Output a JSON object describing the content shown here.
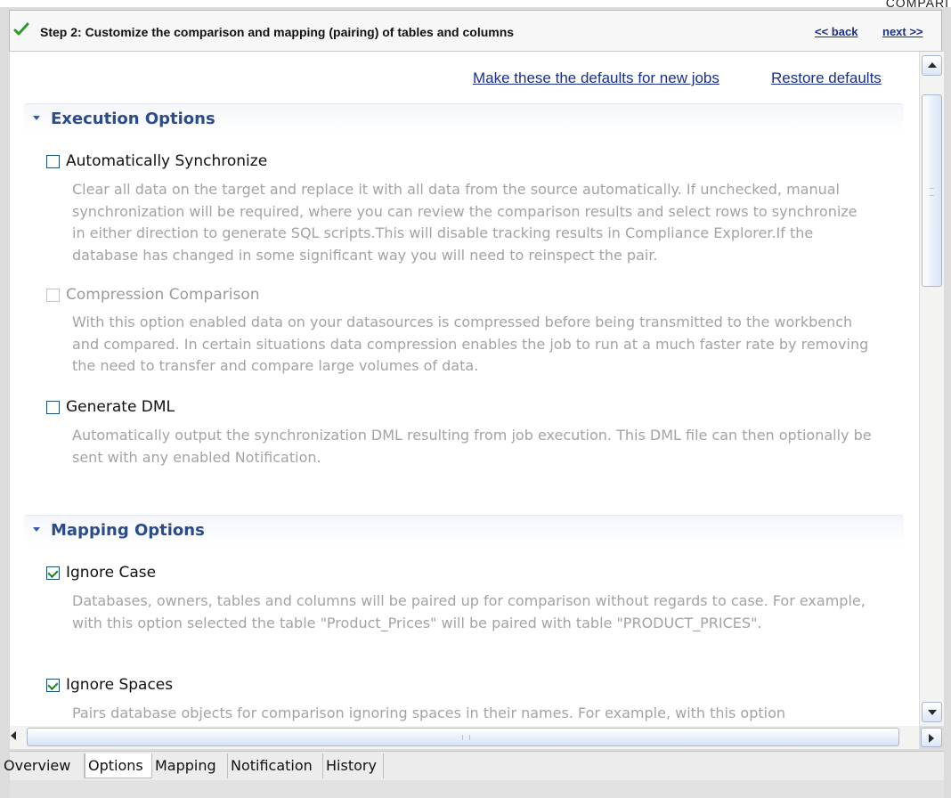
{
  "corner_text": "COMPARI",
  "header": {
    "step_title": "Step 2: Customize the comparison and mapping (pairing) of tables and columns",
    "back_label": "<< back",
    "next_label": "next >>"
  },
  "defaults": {
    "make_default_label": "Make these the defaults for new jobs",
    "restore_label": "Restore defaults"
  },
  "sections": {
    "execution": {
      "title": "Execution Options",
      "options": [
        {
          "label": "Automatically Synchronize",
          "checked": false,
          "enabled": true,
          "description": "Clear all data on the target and replace it with all data from the source automatically. If unchecked, manual synchronization will be required, where you can review the comparison results and select rows to synchronize in either direction to generate SQL scripts.This will disable tracking results in Compliance Explorer.If the database has changed in some significant way you will need to reinspect the pair."
        },
        {
          "label": "Compression Comparison",
          "checked": false,
          "enabled": false,
          "description": "With this option enabled data on your datasources is compressed before being transmitted to the workbench and compared. In certain situations data compression enables the job to run at a much faster rate by removing the need to transfer and compare large volumes of data."
        },
        {
          "label": "Generate DML",
          "checked": false,
          "enabled": true,
          "description": "Automatically output the synchronization DML resulting from job execution. This DML file can then optionally be sent with any enabled Notification."
        }
      ]
    },
    "mapping": {
      "title": "Mapping Options",
      "options": [
        {
          "label": "Ignore Case",
          "checked": true,
          "enabled": true,
          "description": "Databases, owners, tables and columns will be paired up for comparison without regards to case. For example, with this option selected the table \"Product_Prices\" will be paired with table \"PRODUCT_PRICES\"."
        },
        {
          "label": "Ignore Spaces",
          "checked": true,
          "enabled": true,
          "description": "Pairs database objects for comparison ignoring spaces in their names. For example, with this option"
        }
      ]
    }
  },
  "tabs": [
    {
      "label": "Overview",
      "active": false
    },
    {
      "label": "Options",
      "active": true
    },
    {
      "label": "Mapping",
      "active": false
    },
    {
      "label": "Notification",
      "active": false
    },
    {
      "label": "History",
      "active": false
    }
  ],
  "colors": {
    "link": "#1a2f8a",
    "section_title": "#2b4b8c",
    "description_text": "#a3a3a3",
    "check_mark": "#1f7f1f"
  },
  "icons": {
    "step_status": "check-icon",
    "section_toggle": "triangle-down-icon"
  }
}
